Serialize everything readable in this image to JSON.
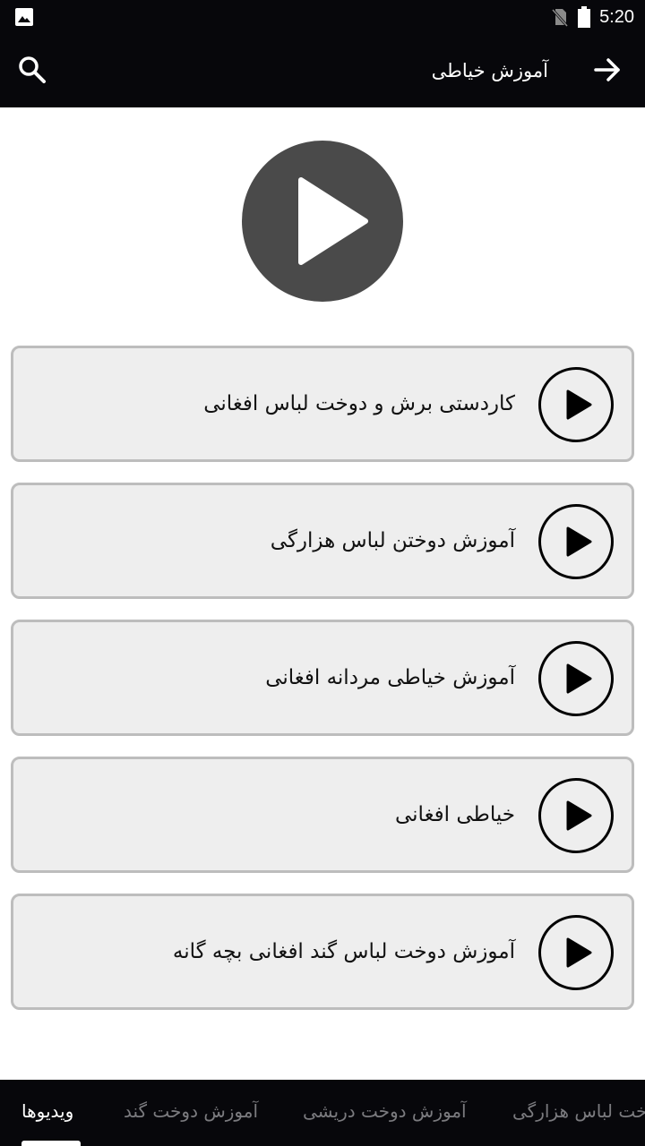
{
  "status_bar": {
    "time": "5:20",
    "icons": [
      "image-icon",
      "no-sim-icon",
      "battery-icon"
    ]
  },
  "app_bar": {
    "title": "آموزش خیاطی",
    "icons": [
      "search-icon",
      "arrow-right-icon"
    ]
  },
  "list": {
    "items": [
      {
        "label": "کاردستی برش و دوخت لباس افغانی"
      },
      {
        "label": "آموزش دوختن لباس هزارگی"
      },
      {
        "label": "آموزش خیاطی مردانه افغانی"
      },
      {
        "label": "خیاطی افغانی"
      },
      {
        "label": "آموزش دوخت لباس گند افغانی بچه گانه"
      }
    ]
  },
  "bottom_tabs": {
    "items": [
      {
        "label": "ویدیوها",
        "active": true
      },
      {
        "label": "آموزش دوخت گند",
        "active": false
      },
      {
        "label": "آموزش دوخت دریشی",
        "active": false
      },
      {
        "label": "آموزش دوخت لباس هزارگی",
        "active": false
      }
    ]
  },
  "colors": {
    "bar_background": "#07070b",
    "card_background": "#eeeeee",
    "card_border": "#bdbdbd",
    "hero_play": "#4a4a4a",
    "inactive_tab": "#7b7b7f"
  }
}
